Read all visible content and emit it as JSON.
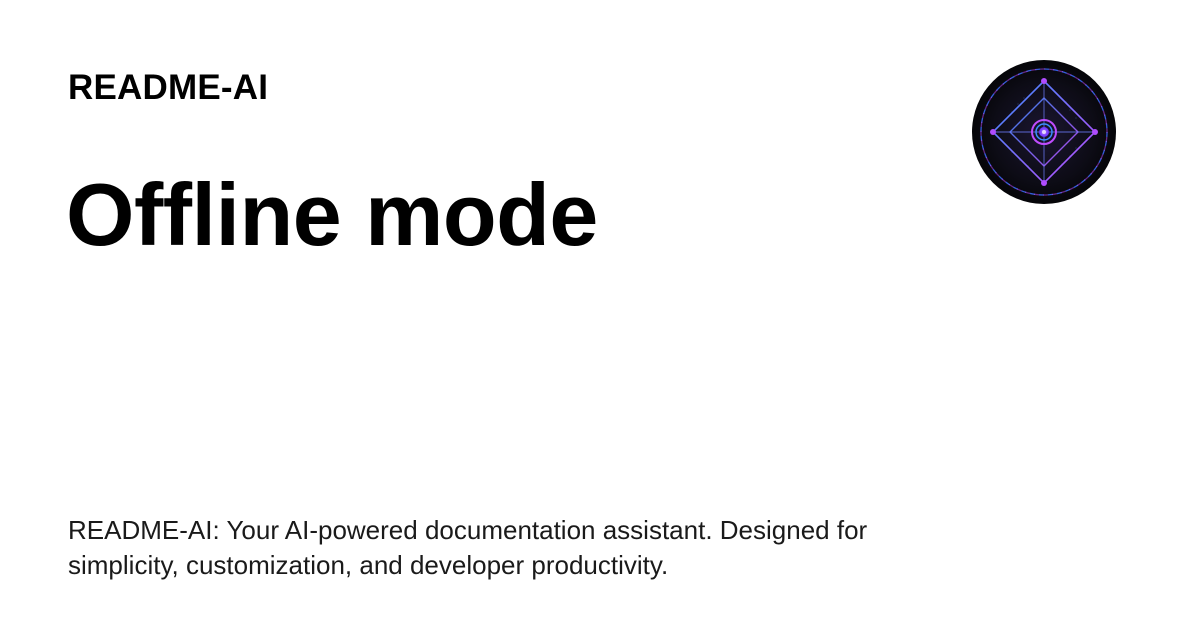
{
  "header": {
    "site_name": "README-AI"
  },
  "main": {
    "title": "Offline mode",
    "description": "README-AI: Your AI-powered documentation assistant. Designed for simplicity, customization, and developer productivity."
  },
  "logo": {
    "icon": "readme-ai-logo-icon",
    "colors": {
      "background": "#0b0b12",
      "accent_blue": "#3b8dff",
      "accent_purple": "#b04cff",
      "accent_magenta": "#e040fb"
    }
  }
}
